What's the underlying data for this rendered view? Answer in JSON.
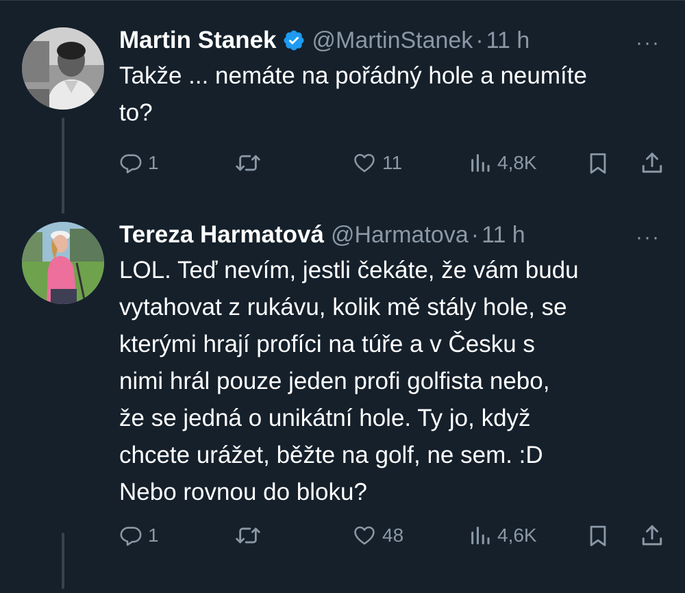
{
  "tweets": [
    {
      "author_name": "Martin Stanek",
      "verified": true,
      "handle": "@MartinStanek",
      "dot": "·",
      "time": "11 h",
      "more_icon": "···",
      "text": "Takže ... nemáte na pořádný hole a neumíte\nto?",
      "replies": "1",
      "likes": "11",
      "views": "4,8K"
    },
    {
      "author_name": "Tereza Harmatová",
      "verified": false,
      "handle": "@Harmatova",
      "dot": "·",
      "time": "11 h",
      "more_icon": "···",
      "text": "LOL. Teď nevím, jestli čekáte, že vám budu\nvytahovat z rukávu, kolik mě stály hole, se\nkterými hrají profíci na túře a v Česku s\nnimi hrál pouze jeden profi golfista nebo,\nže se jedná o unikátní hole. Ty jo, když\nchcete urážet, běžte na golf, ne sem. :D\nNebo rovnou do bloku?",
      "replies": "1",
      "likes": "48",
      "views": "4,6K"
    }
  ],
  "icons": {
    "reply": "reply-icon",
    "retweet": "retweet-icon",
    "like": "heart-icon",
    "views": "views-icon",
    "bookmark": "bookmark-icon",
    "share": "share-icon",
    "verified": "verified-badge-icon"
  },
  "colors": {
    "background": "#15202b",
    "text_primary": "#ffffff",
    "text_secondary": "#8b98a5",
    "verified": "#1d9bf0",
    "thread_line": "#38444d"
  }
}
